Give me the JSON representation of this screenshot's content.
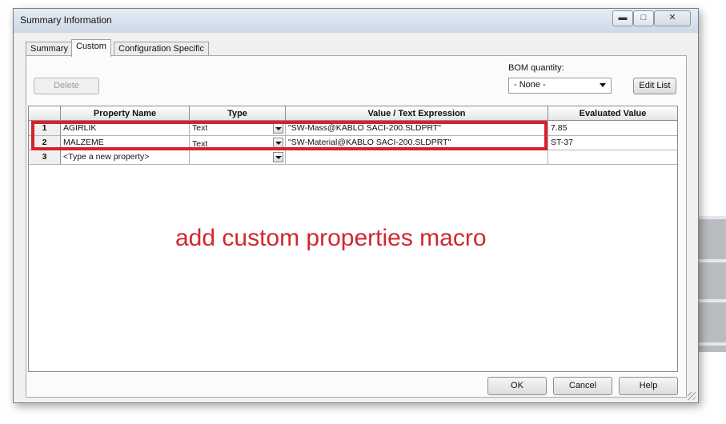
{
  "window": {
    "title": "Summary Information"
  },
  "tabs": [
    {
      "label": "Summary"
    },
    {
      "label": "Custom"
    },
    {
      "label": "Configuration Specific"
    }
  ],
  "toolbar": {
    "delete_label": "Delete",
    "bom_label": "BOM quantity:",
    "bom_value": "- None -",
    "edit_list_label": "Edit List"
  },
  "table": {
    "columns": [
      "Property Name",
      "Type",
      "Value / Text Expression",
      "Evaluated Value"
    ],
    "rows": [
      {
        "num": "1",
        "name": "AGIRLIK",
        "type": "Text",
        "value": "\"SW-Mass@KABLO SACI-200.SLDPRT\"",
        "evaluated": "7.85"
      },
      {
        "num": "2",
        "name": "MALZEME",
        "type": "Text",
        "value": "\"SW-Material@KABLO SACI-200.SLDPRT\"",
        "evaluated": "ST-37"
      },
      {
        "num": "3",
        "name": "<Type a new property>",
        "type": "",
        "value": "",
        "evaluated": ""
      }
    ]
  },
  "annotation": "add custom properties macro",
  "footer": {
    "ok_label": "OK",
    "cancel_label": "Cancel",
    "help_label": "Help"
  },
  "colors": {
    "annotation": "#d1272f",
    "titlebar": "#dbe4ef"
  }
}
